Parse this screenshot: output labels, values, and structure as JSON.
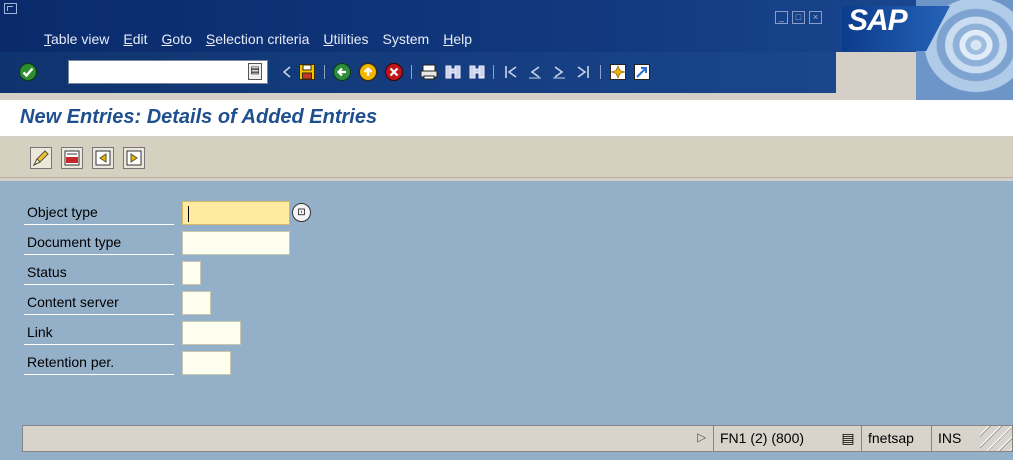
{
  "menubar": {
    "items": [
      {
        "mnemonic": "T",
        "rest": "able view"
      },
      {
        "mnemonic": "E",
        "rest": "dit"
      },
      {
        "mnemonic": "G",
        "rest": "oto"
      },
      {
        "mnemonic": "S",
        "rest": "election criteria"
      },
      {
        "mnemonic": "U",
        "rest": "tilities"
      },
      {
        "mnemonic": "",
        "rest": "System"
      },
      {
        "mnemonic": "H",
        "rest": "elp"
      }
    ],
    "logo_text": "SAP"
  },
  "toolbar": {
    "command_field_value": "",
    "icons": [
      "enter-check-icon",
      "dropdown-icon",
      "prev-icon",
      "save-icon",
      "back-icon",
      "exit-icon",
      "cancel-icon",
      "print-icon",
      "find-icon",
      "find-next-icon",
      "first-page-icon",
      "prev-page-icon",
      "next-page-icon",
      "last-page-icon",
      "create-session-icon",
      "help-icon"
    ]
  },
  "screen_title": "New Entries: Details of Added Entries",
  "app_toolbar": {
    "icons": [
      "change-icon",
      "delete-icon",
      "previous-entry-icon",
      "next-entry-icon"
    ]
  },
  "form": {
    "fields": [
      {
        "label": "Object type",
        "value": ""
      },
      {
        "label": "Document type",
        "value": ""
      },
      {
        "label": "Status",
        "value": ""
      },
      {
        "label": "Content server",
        "value": ""
      },
      {
        "label": "Link",
        "value": ""
      },
      {
        "label": "Retention per.",
        "value": ""
      }
    ]
  },
  "statusbar": {
    "system": "FN1 (2) (800)",
    "server": "fnetsap",
    "mode": "INS"
  },
  "colors": {
    "title_text": "#1e4f8e",
    "main_bg": "#93b0c8",
    "required_field": "#ffeaa0"
  }
}
